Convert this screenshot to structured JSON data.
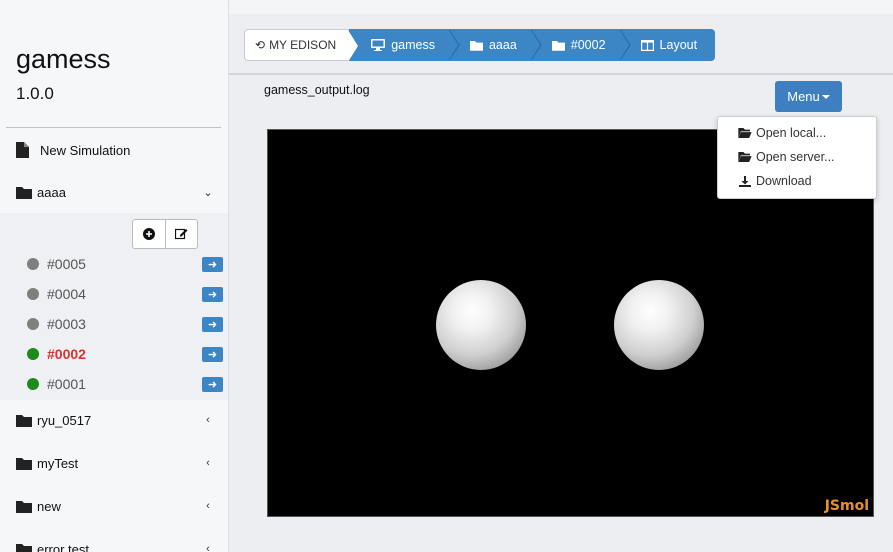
{
  "sidebar": {
    "app_title": "gamess",
    "app_version": "1.0.0",
    "new_simulation": "New Simulation",
    "folders": [
      {
        "label": "aaaa",
        "expanded": true
      },
      {
        "label": "ryu_0517",
        "expanded": false
      },
      {
        "label": "myTest",
        "expanded": false
      },
      {
        "label": "new",
        "expanded": false
      },
      {
        "label": "error test",
        "expanded": false
      }
    ],
    "jobs": [
      {
        "label": "#0005",
        "status_color": "#7f7f7f"
      },
      {
        "label": "#0004",
        "status_color": "#7f7f7f"
      },
      {
        "label": "#0003",
        "status_color": "#7f7f7f"
      },
      {
        "label": "#0002",
        "status_color": "#1e8a1e",
        "active": true
      },
      {
        "label": "#0001",
        "status_color": "#1e8a1e"
      }
    ]
  },
  "breadcrumb": {
    "home": "MY EDISON",
    "items": [
      {
        "label": "gamess",
        "icon": "monitor-icon"
      },
      {
        "label": "aaaa",
        "icon": "folder-icon"
      },
      {
        "label": "#0002",
        "icon": "folder-icon"
      },
      {
        "label": "Layout",
        "icon": "columns-icon"
      }
    ]
  },
  "viewer": {
    "file_name": "gamess_output.log",
    "brand": "JSmol"
  },
  "menu": {
    "label": "Menu",
    "items": [
      {
        "label": "Open local...",
        "icon": "folder-open-icon"
      },
      {
        "label": "Open server...",
        "icon": "folder-open-icon"
      },
      {
        "label": "Download",
        "icon": "download-icon"
      }
    ]
  },
  "colors": {
    "accent": "#3d86c6",
    "active_job": "#d9312e",
    "jsmol_brand": "#e8912c"
  }
}
